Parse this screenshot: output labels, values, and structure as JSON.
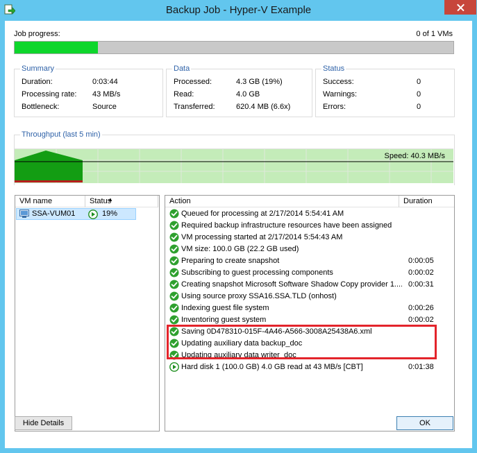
{
  "window": {
    "title": "Backup Job - Hyper-V Example"
  },
  "job_progress": {
    "label": "Job progress:",
    "count": "0 of 1 VMs",
    "fraction": 0.19
  },
  "summary": {
    "title": "Summary",
    "rows": [
      {
        "label": "Duration:",
        "value": "0:03:44"
      },
      {
        "label": "Processing rate:",
        "value": "43 MB/s"
      },
      {
        "label": "Bottleneck:",
        "value": "Source"
      }
    ]
  },
  "data": {
    "title": "Data",
    "rows": [
      {
        "label": "Processed:",
        "value": "4.3 GB (19%)"
      },
      {
        "label": "Read:",
        "value": "4.0 GB"
      },
      {
        "label": "Transferred:",
        "value": "620.4 MB (6.6x)"
      }
    ]
  },
  "status": {
    "title": "Status",
    "rows": [
      {
        "label": "Success:",
        "value": "0"
      },
      {
        "label": "Warnings:",
        "value": "0"
      },
      {
        "label": "Errors:",
        "value": "0"
      }
    ]
  },
  "throughput": {
    "title": "Throughput (last 5 min)",
    "speed": "Speed: 40.3 MB/s"
  },
  "vm_list": {
    "columns": [
      "VM name",
      "Status"
    ],
    "rows": [
      {
        "name": "SSA-VUM01",
        "status": "19%"
      }
    ]
  },
  "log": {
    "columns": [
      "Action",
      "Duration"
    ],
    "rows": [
      {
        "action": "Queued for processing at 2/17/2014 5:54:41 AM",
        "duration": ""
      },
      {
        "action": "Required backup infrastructure resources have been assigned",
        "duration": ""
      },
      {
        "action": "VM processing started at 2/17/2014 5:54:43 AM",
        "duration": ""
      },
      {
        "action": "VM size: 100.0 GB (22.2 GB used)",
        "duration": ""
      },
      {
        "action": "Preparing to create snapshot",
        "duration": "0:00:05"
      },
      {
        "action": "Subscribing to guest processing components",
        "duration": "0:00:02"
      },
      {
        "action": "Creating snapshot Microsoft Software Shadow Copy provider 1....",
        "duration": "0:00:31"
      },
      {
        "action": "Using source proxy SSA16.SSA.TLD (onhost)",
        "duration": ""
      },
      {
        "action": "Indexing guest file system",
        "duration": "0:00:26"
      },
      {
        "action": "Inventoring guest system",
        "duration": "0:00:02"
      },
      {
        "action": "Saving 0D478310-015F-4A46-A566-3008A25438A6.xml",
        "duration": ""
      },
      {
        "action": "Updating auxiliary data backup_doc",
        "duration": ""
      },
      {
        "action": "Updating auxiliary data writer_doc",
        "duration": ""
      },
      {
        "action": "Hard disk 1 (100.0 GB) 4.0 GB read at 43 MB/s [CBT]",
        "duration": "0:01:38"
      }
    ]
  },
  "buttons": {
    "hide_details": "Hide Details",
    "ok": "OK"
  },
  "colors": {
    "accent": "#2f62a8",
    "progress": "#0ed62c",
    "highlight": "#e3242b",
    "chrome": "#62c6ee"
  }
}
